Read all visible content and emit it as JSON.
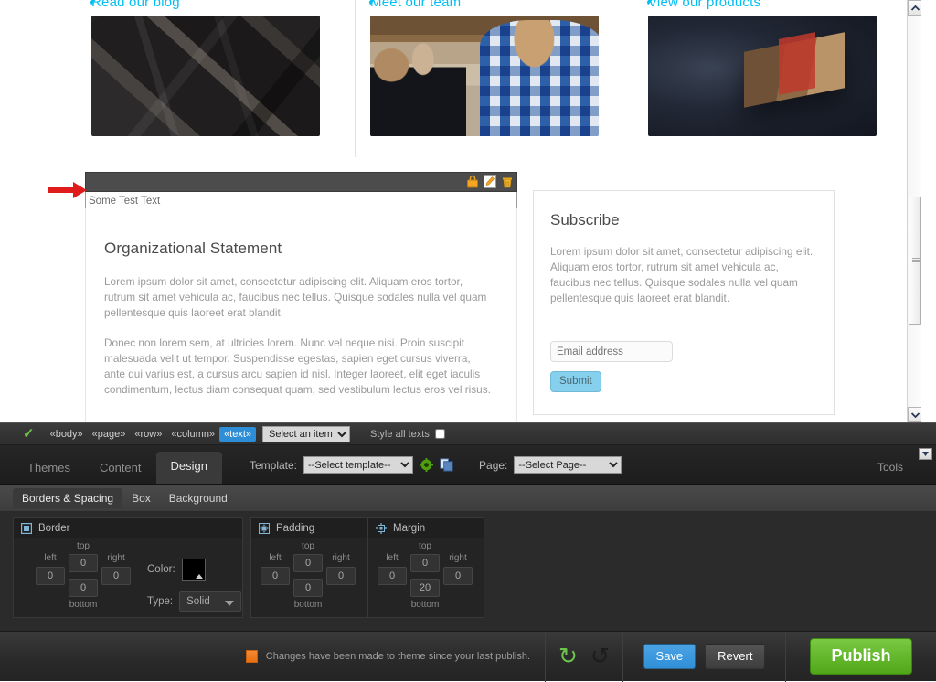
{
  "preview": {
    "promos": [
      {
        "label": "Read our blog",
        "icon": "pencil-icon",
        "image": "business-cards-photo"
      },
      {
        "label": "Meet our team",
        "icon": "pencil-icon",
        "image": "people-networking-photo"
      },
      {
        "label": "View our products",
        "icon": "pencil-icon",
        "image": "gift-box-photo"
      }
    ],
    "selected_widget": {
      "text_value": "Some Test Text",
      "tools": [
        "lock-icon",
        "edit-icon",
        "delete-icon"
      ]
    },
    "org_card": {
      "heading": "Organizational Statement",
      "paragraph1": "Lorem ipsum dolor sit amet, consectetur adipiscing elit. Aliquam eros tortor, rutrum sit amet vehicula ac, faucibus nec tellus. Quisque sodales nulla vel quam pellentesque quis laoreet erat blandit.",
      "paragraph2": "Donec non lorem sem, at ultricies lorem. Nunc vel neque nisi. Proin suscipit malesuada velit ut tempor. Suspendisse egestas, sapien eget cursus viverra, ante dui varius est, a cursus arcu sapien id nisl. Integer laoreet, elit eget iaculis condimentum, lectus diam consequat quam, sed vestibulum lectus eros vel risus."
    },
    "subscribe_card": {
      "heading": "Subscribe",
      "paragraph": "Lorem ipsum dolor sit amet, consectetur adipiscing elit. Aliquam eros tortor, rutrum sit amet vehicula ac, faucibus nec tellus. Quisque sodales nulla vel quam pellentesque quis laoreet erat blandit.",
      "email_placeholder": "Email address",
      "email_value": "",
      "submit_label": "Submit"
    }
  },
  "editor": {
    "breadcrumb": {
      "status_icon": "checkmark-icon",
      "items": [
        "«body»",
        "«page»",
        "«row»",
        "«column»",
        "«text»"
      ],
      "active_index": 4,
      "item_select_value": "Select an item",
      "style_all_label": "Style all texts",
      "style_all_checked": false
    },
    "main_tabs": [
      {
        "label": "Themes",
        "active": false
      },
      {
        "label": "Content",
        "active": false
      },
      {
        "label": "Design",
        "active": true
      }
    ],
    "template": {
      "label": "Template:",
      "value": "--Select template--",
      "gear_icon": "gear-icon",
      "copy_icon": "copy-icon"
    },
    "page": {
      "label": "Page:",
      "value": "--Select Page--"
    },
    "tools_label": "Tools",
    "collapse_icon": "collapse-icon",
    "sub_tabs": [
      {
        "label": "Borders & Spacing",
        "active": true
      },
      {
        "label": "Box",
        "active": false
      },
      {
        "label": "Background",
        "active": false
      }
    ],
    "panels": {
      "border": {
        "title": "Border",
        "icon": "border-icon",
        "left_label": "left",
        "left": "0",
        "top_label": "top",
        "top": "0",
        "right_label": "right",
        "right": "0",
        "bottom_label": "bottom",
        "bottom": "0",
        "color_label": "Color:",
        "color_value": "#000000",
        "type_label": "Type:",
        "type_value": "Solid"
      },
      "padding": {
        "title": "Padding",
        "icon": "padding-icon",
        "left_label": "left",
        "left": "0",
        "top_label": "top",
        "top": "0",
        "right_label": "right",
        "right": "0",
        "bottom_label": "bottom",
        "bottom": "0"
      },
      "margin": {
        "title": "Margin",
        "icon": "margin-icon",
        "left_label": "left",
        "left": "0",
        "top_label": "top",
        "top": "0",
        "right_label": "right",
        "right": "0",
        "bottom_label": "bottom",
        "bottom": "20"
      }
    },
    "action_bar": {
      "status_text": "Changes have been made to theme since your last publish.",
      "status_swatch_color": "#f0791c",
      "undo_icon": "undo-icon",
      "redo_icon": "redo-icon",
      "save_label": "Save",
      "revert_label": "Revert",
      "publish_label": "Publish",
      "publish_color": "#5cb316",
      "save_color": "#3790d8"
    }
  },
  "scrollbar": {
    "up_icon": "chevron-up-icon",
    "down_icon": "chevron-down-icon",
    "thumb_name": "scrollbar-thumb"
  },
  "annotation": {
    "arrow": "red-arrow-annotation"
  }
}
